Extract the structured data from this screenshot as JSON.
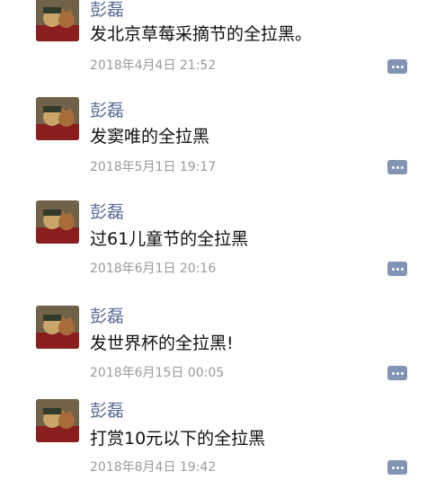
{
  "posts": [
    {
      "author": "彭磊",
      "content": "发北京草莓采摘节的全拉黑。",
      "time": "2018年4月4日 21:52",
      "comment_icon": "comment-dots-icon"
    },
    {
      "author": "彭磊",
      "content": "发窦唯的全拉黑",
      "time": "2018年5月1日 19:17",
      "comment_icon": "comment-dots-icon"
    },
    {
      "author": "彭磊",
      "content": "过61儿童节的全拉黑",
      "time": "2018年6月1日 20:16",
      "comment_icon": "comment-dots-icon"
    },
    {
      "author": "彭磊",
      "content": "发世界杯的全拉黑!",
      "time": "2018年6月15日 00:05",
      "comment_icon": "comment-dots-icon"
    },
    {
      "author": "彭磊",
      "content": "打赏10元以下的全拉黑",
      "time": "2018年8月4日 19:42",
      "comment_icon": "comment-dots-icon"
    }
  ],
  "colors": {
    "author": "#576b95",
    "content": "#111111",
    "time": "#9a9a9a",
    "comment_button": "#8294b4"
  }
}
